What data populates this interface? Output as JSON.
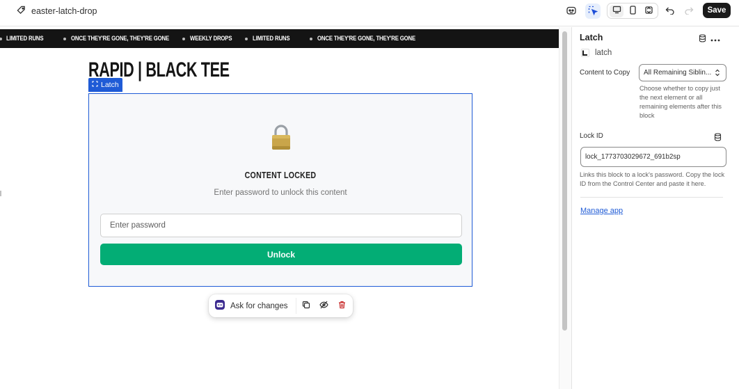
{
  "topbar": {
    "title": "easter-latch-drop",
    "save_label": "Save"
  },
  "marquee": {
    "items": [
      "LIMITED RUNS",
      "ONCE THEY'RE GONE, THEY'RE GONE",
      "WEEKLY DROPS",
      "LIMITED RUNS",
      "ONCE THEY'RE GONE, THEY'RE GONE"
    ]
  },
  "canvas": {
    "page_title": "RAPID | BLACK TEE",
    "latch_tag": "Latch",
    "lock_emoji": "🔒",
    "locked_title": "CONTENT LOCKED",
    "locked_subtitle": "Enter password to unlock this content",
    "password_placeholder": "Enter password",
    "unlock_label": "Unlock"
  },
  "floatbar": {
    "ask_label": "Ask for changes"
  },
  "panel": {
    "title": "Latch",
    "app_name": "latch",
    "content_to_copy_label": "Content to Copy",
    "content_to_copy_value": "All Remaining Siblin...",
    "content_to_copy_help": "Choose whether to copy just the next element or all remaining elements after this block",
    "lock_id_label": "Lock ID",
    "lock_id_value": "lock_1773703029672_691b2sp",
    "lock_id_help": "Links this block to a lock's password. Copy the lock ID from the Control Center and paste it here.",
    "manage_app": "Manage app"
  },
  "colors": {
    "accent_blue": "#1f5bd6",
    "unlock_green": "#03ad75",
    "marquee_bg": "#141414",
    "save_bg": "#1a1a1a"
  }
}
